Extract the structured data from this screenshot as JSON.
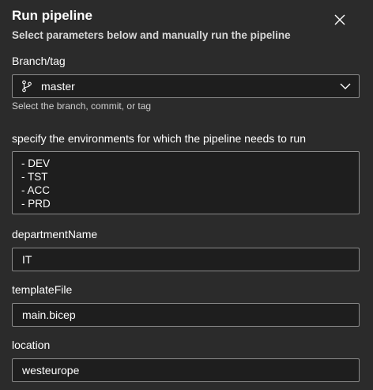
{
  "dialog": {
    "title": "Run pipeline",
    "subtitle": "Select parameters below and manually run the pipeline",
    "close_icon": "close-icon"
  },
  "branch": {
    "label": "Branch/tag",
    "value": "master",
    "icon": "branch-icon",
    "helper": "Select the branch, commit, or tag"
  },
  "environments": {
    "label": "specify the environments for which the pipeline needs to run",
    "lines": [
      "- DEV",
      "- TST",
      "- ACC",
      "- PRD"
    ]
  },
  "departmentName": {
    "label": "departmentName",
    "value": "IT"
  },
  "templateFile": {
    "label": "templateFile",
    "value": "main.bicep"
  },
  "location": {
    "label": "location",
    "value": "westeurope"
  },
  "colors": {
    "background": "#2b2b2b",
    "field_background": "#1e1e1e",
    "field_border": "#8a8a8a",
    "text": "#ffffff"
  }
}
